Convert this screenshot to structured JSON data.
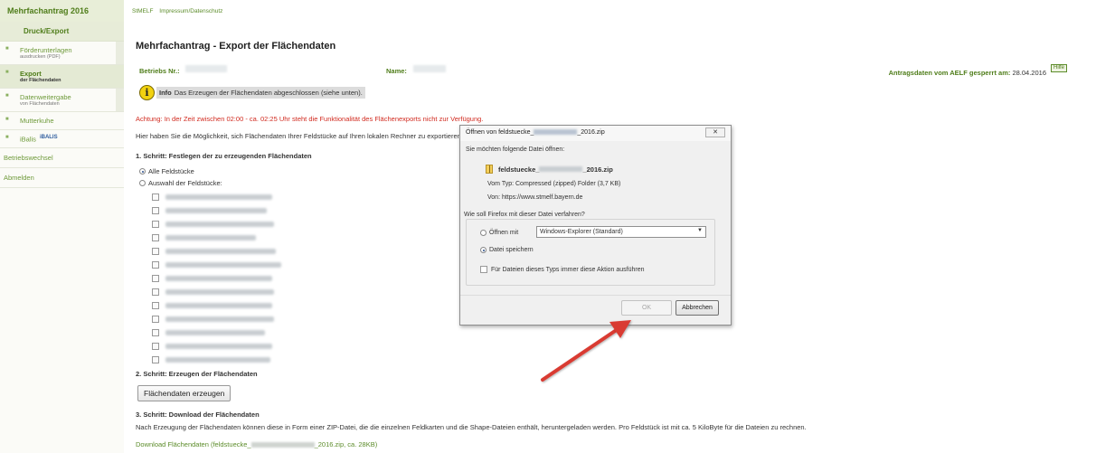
{
  "header": {
    "app_title": "Mehrfachantrag 2016",
    "links": [
      "StMELF",
      "Impressum/Datenschutz"
    ]
  },
  "sidebar": {
    "section": "Druck/Export",
    "items": [
      {
        "main": "Förderunterlagen",
        "sub": "ausdrucken (PDF)"
      },
      {
        "main": "Export",
        "sub": "der Flächendaten"
      },
      {
        "main": "Datenweitergabe",
        "sub": "von Flächendaten"
      },
      {
        "main": "Mutterkuhe",
        "sub": ""
      },
      {
        "main": "iBalis",
        "sub": ""
      }
    ],
    "plain": [
      "Betriebswechsel",
      "Abmelden"
    ],
    "ibalis_logo": "iBALIS"
  },
  "page": {
    "title": "Mehrfachantrag - Export der Flächendaten",
    "betrieb_label": "Betriebs Nr.:",
    "name_label": "Name:",
    "gesperrt_label": "Antragsdaten vom AELF gesperrt am:",
    "gesperrt_date": "28.04.2016",
    "help_badge": "Hilfe",
    "info_label": "Info",
    "info_text": "Das Erzeugen der Flächendaten abgeschlossen (siehe unten).",
    "warning": "Achtung: In der Zeit zwischen 02:00 - ca. 02:25 Uhr steht die Funktionalität des Flächenexports nicht zur Verfügung.",
    "description": "Hier haben Sie die Möglichkeit, sich Flächendaten Ihrer Feldstücke auf Ihren lokalen Rechner zu exportieren.",
    "step1_title": "1. Schritt: Festlegen der zu erzeugenden Flächendaten",
    "radio_all": "Alle Feldstücke",
    "radio_selection": "Auswahl der Feldstücke:",
    "step2_title": "2. Schritt: Erzeugen der Flächendaten",
    "button_erzeugen": "Flächendaten erzeugen",
    "step3_title": "3. Schritt: Download der Flächendaten",
    "step3_desc": "Nach Erzeugung der Flächendaten können diese in Form einer ZIP-Datei, die die einzelnen Feldkarten und die Shape-Dateien enthält, heruntergeladen werden. Pro Feldstück ist mit ca. 5 KiloByte für die Dateien zu rechnen.",
    "download_prefix": "Download Flächendaten (feldstuecke_",
    "download_suffix": "_2016.zip, ca. 28KB)"
  },
  "dialog": {
    "title_prefix": "Öffnen von feldstuecke_",
    "title_suffix": "_2016.zip",
    "close": "✕",
    "intro": "Sie möchten folgende Datei öffnen:",
    "file_prefix": "feldstuecke_",
    "file_suffix": "_2016.zip",
    "type_line": "Vom Typ: Compressed (zipped) Folder (3,7 KB)",
    "from_line": "Von: https://www.stmelf.bayern.de",
    "question": "Wie soll Firefox mit dieser Datei verfahren?",
    "open_with": "Öffnen mit",
    "open_with_value": "Windows-Explorer (Standard)",
    "save_file": "Datei speichern",
    "always_checkbox": "Für Dateien dieses Typs immer diese Aktion ausführen",
    "ok": "OK",
    "cancel": "Abbrechen"
  },
  "colors": {
    "accent_green": "#4f7d1a",
    "warning_red": "#d12a1f",
    "arrow_red": "#d93a33"
  }
}
